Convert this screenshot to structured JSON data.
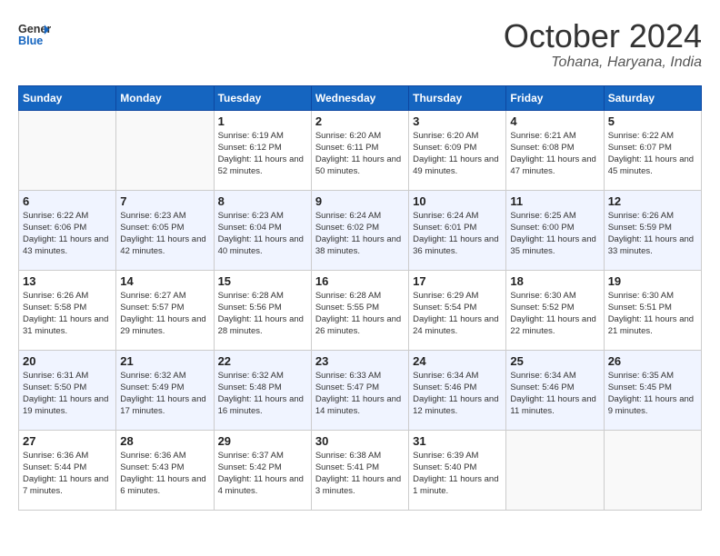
{
  "header": {
    "logo_general": "General",
    "logo_blue": "Blue",
    "month_title": "October 2024",
    "location": "Tohana, Haryana, India"
  },
  "weekdays": [
    "Sunday",
    "Monday",
    "Tuesday",
    "Wednesday",
    "Thursday",
    "Friday",
    "Saturday"
  ],
  "weeks": [
    [
      {
        "day": "",
        "info": ""
      },
      {
        "day": "",
        "info": ""
      },
      {
        "day": "1",
        "info": "Sunrise: 6:19 AM\nSunset: 6:12 PM\nDaylight: 11 hours and 52 minutes."
      },
      {
        "day": "2",
        "info": "Sunrise: 6:20 AM\nSunset: 6:11 PM\nDaylight: 11 hours and 50 minutes."
      },
      {
        "day": "3",
        "info": "Sunrise: 6:20 AM\nSunset: 6:09 PM\nDaylight: 11 hours and 49 minutes."
      },
      {
        "day": "4",
        "info": "Sunrise: 6:21 AM\nSunset: 6:08 PM\nDaylight: 11 hours and 47 minutes."
      },
      {
        "day": "5",
        "info": "Sunrise: 6:22 AM\nSunset: 6:07 PM\nDaylight: 11 hours and 45 minutes."
      }
    ],
    [
      {
        "day": "6",
        "info": "Sunrise: 6:22 AM\nSunset: 6:06 PM\nDaylight: 11 hours and 43 minutes."
      },
      {
        "day": "7",
        "info": "Sunrise: 6:23 AM\nSunset: 6:05 PM\nDaylight: 11 hours and 42 minutes."
      },
      {
        "day": "8",
        "info": "Sunrise: 6:23 AM\nSunset: 6:04 PM\nDaylight: 11 hours and 40 minutes."
      },
      {
        "day": "9",
        "info": "Sunrise: 6:24 AM\nSunset: 6:02 PM\nDaylight: 11 hours and 38 minutes."
      },
      {
        "day": "10",
        "info": "Sunrise: 6:24 AM\nSunset: 6:01 PM\nDaylight: 11 hours and 36 minutes."
      },
      {
        "day": "11",
        "info": "Sunrise: 6:25 AM\nSunset: 6:00 PM\nDaylight: 11 hours and 35 minutes."
      },
      {
        "day": "12",
        "info": "Sunrise: 6:26 AM\nSunset: 5:59 PM\nDaylight: 11 hours and 33 minutes."
      }
    ],
    [
      {
        "day": "13",
        "info": "Sunrise: 6:26 AM\nSunset: 5:58 PM\nDaylight: 11 hours and 31 minutes."
      },
      {
        "day": "14",
        "info": "Sunrise: 6:27 AM\nSunset: 5:57 PM\nDaylight: 11 hours and 29 minutes."
      },
      {
        "day": "15",
        "info": "Sunrise: 6:28 AM\nSunset: 5:56 PM\nDaylight: 11 hours and 28 minutes."
      },
      {
        "day": "16",
        "info": "Sunrise: 6:28 AM\nSunset: 5:55 PM\nDaylight: 11 hours and 26 minutes."
      },
      {
        "day": "17",
        "info": "Sunrise: 6:29 AM\nSunset: 5:54 PM\nDaylight: 11 hours and 24 minutes."
      },
      {
        "day": "18",
        "info": "Sunrise: 6:30 AM\nSunset: 5:52 PM\nDaylight: 11 hours and 22 minutes."
      },
      {
        "day": "19",
        "info": "Sunrise: 6:30 AM\nSunset: 5:51 PM\nDaylight: 11 hours and 21 minutes."
      }
    ],
    [
      {
        "day": "20",
        "info": "Sunrise: 6:31 AM\nSunset: 5:50 PM\nDaylight: 11 hours and 19 minutes."
      },
      {
        "day": "21",
        "info": "Sunrise: 6:32 AM\nSunset: 5:49 PM\nDaylight: 11 hours and 17 minutes."
      },
      {
        "day": "22",
        "info": "Sunrise: 6:32 AM\nSunset: 5:48 PM\nDaylight: 11 hours and 16 minutes."
      },
      {
        "day": "23",
        "info": "Sunrise: 6:33 AM\nSunset: 5:47 PM\nDaylight: 11 hours and 14 minutes."
      },
      {
        "day": "24",
        "info": "Sunrise: 6:34 AM\nSunset: 5:46 PM\nDaylight: 11 hours and 12 minutes."
      },
      {
        "day": "25",
        "info": "Sunrise: 6:34 AM\nSunset: 5:46 PM\nDaylight: 11 hours and 11 minutes."
      },
      {
        "day": "26",
        "info": "Sunrise: 6:35 AM\nSunset: 5:45 PM\nDaylight: 11 hours and 9 minutes."
      }
    ],
    [
      {
        "day": "27",
        "info": "Sunrise: 6:36 AM\nSunset: 5:44 PM\nDaylight: 11 hours and 7 minutes."
      },
      {
        "day": "28",
        "info": "Sunrise: 6:36 AM\nSunset: 5:43 PM\nDaylight: 11 hours and 6 minutes."
      },
      {
        "day": "29",
        "info": "Sunrise: 6:37 AM\nSunset: 5:42 PM\nDaylight: 11 hours and 4 minutes."
      },
      {
        "day": "30",
        "info": "Sunrise: 6:38 AM\nSunset: 5:41 PM\nDaylight: 11 hours and 3 minutes."
      },
      {
        "day": "31",
        "info": "Sunrise: 6:39 AM\nSunset: 5:40 PM\nDaylight: 11 hours and 1 minute."
      },
      {
        "day": "",
        "info": ""
      },
      {
        "day": "",
        "info": ""
      }
    ]
  ]
}
